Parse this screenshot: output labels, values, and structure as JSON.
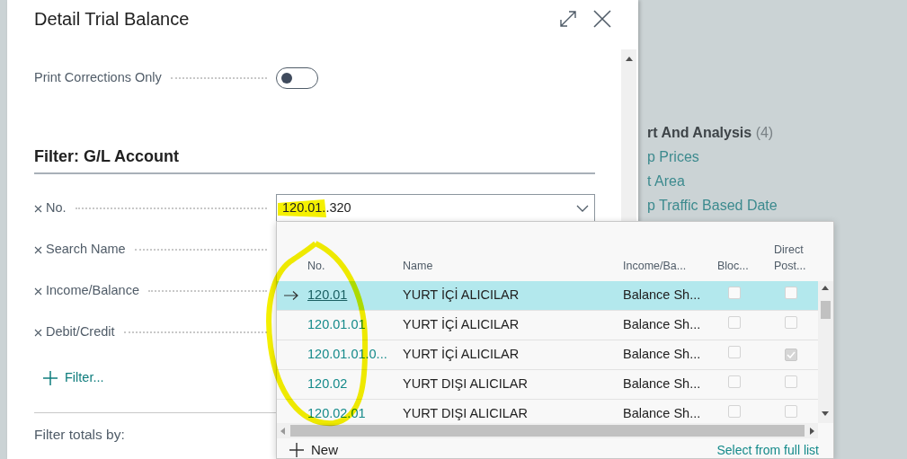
{
  "background": {
    "group_title": "rt And Analysis",
    "group_count": "(4)",
    "links": [
      "p Prices",
      "t Area",
      "p Traffic Based Date"
    ]
  },
  "dialog": {
    "title": "Detail Trial Balance",
    "options": [
      {
        "label": "Print Corrections Only",
        "on": false
      }
    ],
    "filter_section": {
      "title": "Filter: G/L Account",
      "filters": [
        {
          "label": "No.",
          "value": "120.01..320"
        },
        {
          "label": "Search Name"
        },
        {
          "label": "Income/Balance"
        },
        {
          "label": "Debit/Credit"
        }
      ],
      "add_filter": "Filter...",
      "totals_heading": "Filter totals by:"
    }
  },
  "lookup": {
    "columns": [
      "No.",
      "Name",
      "Income/Ba...",
      "Bloc...",
      "Direct Post..."
    ],
    "rows": [
      {
        "no": "120.01",
        "name": "YURT İÇİ ALICILAR",
        "income_balance": "Balance Sh...",
        "blocked": false,
        "direct_posting": false,
        "selected": true
      },
      {
        "no": "120.01.01",
        "name": "YURT İÇİ ALICILAR",
        "income_balance": "Balance Sh...",
        "blocked": false,
        "direct_posting": false,
        "selected": false
      },
      {
        "no": "120.01.01.0...",
        "name": "YURT İÇİ ALICILAR",
        "income_balance": "Balance Sh...",
        "blocked": false,
        "direct_posting": true,
        "selected": false
      },
      {
        "no": "120.02",
        "name": "YURT DIŞI ALICILAR",
        "income_balance": "Balance Sh...",
        "blocked": false,
        "direct_posting": false,
        "selected": false
      },
      {
        "no": "120.02.01",
        "name": "YURT DIŞI ALICILAR",
        "income_balance": "Balance Sh...",
        "blocked": false,
        "direct_posting": false,
        "selected": false
      }
    ],
    "new_action": "New",
    "full_list_link": "Select from full list"
  }
}
